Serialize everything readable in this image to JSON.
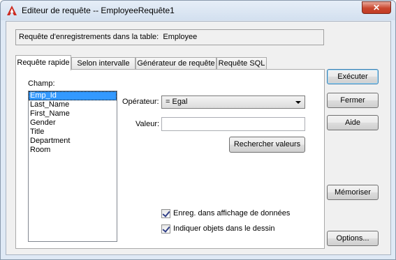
{
  "window": {
    "title": "Editeur de requête -- EmployeeRequête1",
    "close_label": "✕"
  },
  "info": {
    "label": "Requête d'enregistrements dans la table:",
    "table": "Employee"
  },
  "tabs": [
    {
      "label": "Requête rapide",
      "active": true
    },
    {
      "label": "Selon intervalle",
      "active": false
    },
    {
      "label": "Générateur de requête",
      "active": false
    },
    {
      "label": "Requête SQL",
      "active": false
    }
  ],
  "field": {
    "label": "Champ:",
    "items": [
      "Emp_Id",
      "Last_Name",
      "First_Name",
      "Gender",
      "Title",
      "Department",
      "Room"
    ],
    "selected_index": 0
  },
  "operator": {
    "label": "Opérateur:",
    "value": "=   Egal"
  },
  "value_field": {
    "label": "Valeur:",
    "value": ""
  },
  "search_values_button": "Rechercher valeurs",
  "checkboxes": [
    {
      "label": "Enreg. dans affichage de données",
      "checked": true
    },
    {
      "label": "Indiquer objets dans le dessin",
      "checked": true
    }
  ],
  "buttons": {
    "execute": "Exécuter",
    "close": "Fermer",
    "help": "Aide",
    "memorize": "Mémoriser",
    "options": "Options..."
  },
  "colors": {
    "selection": "#3399ff",
    "app_icon": "#cc2a20",
    "close_button": "#c9472f"
  }
}
